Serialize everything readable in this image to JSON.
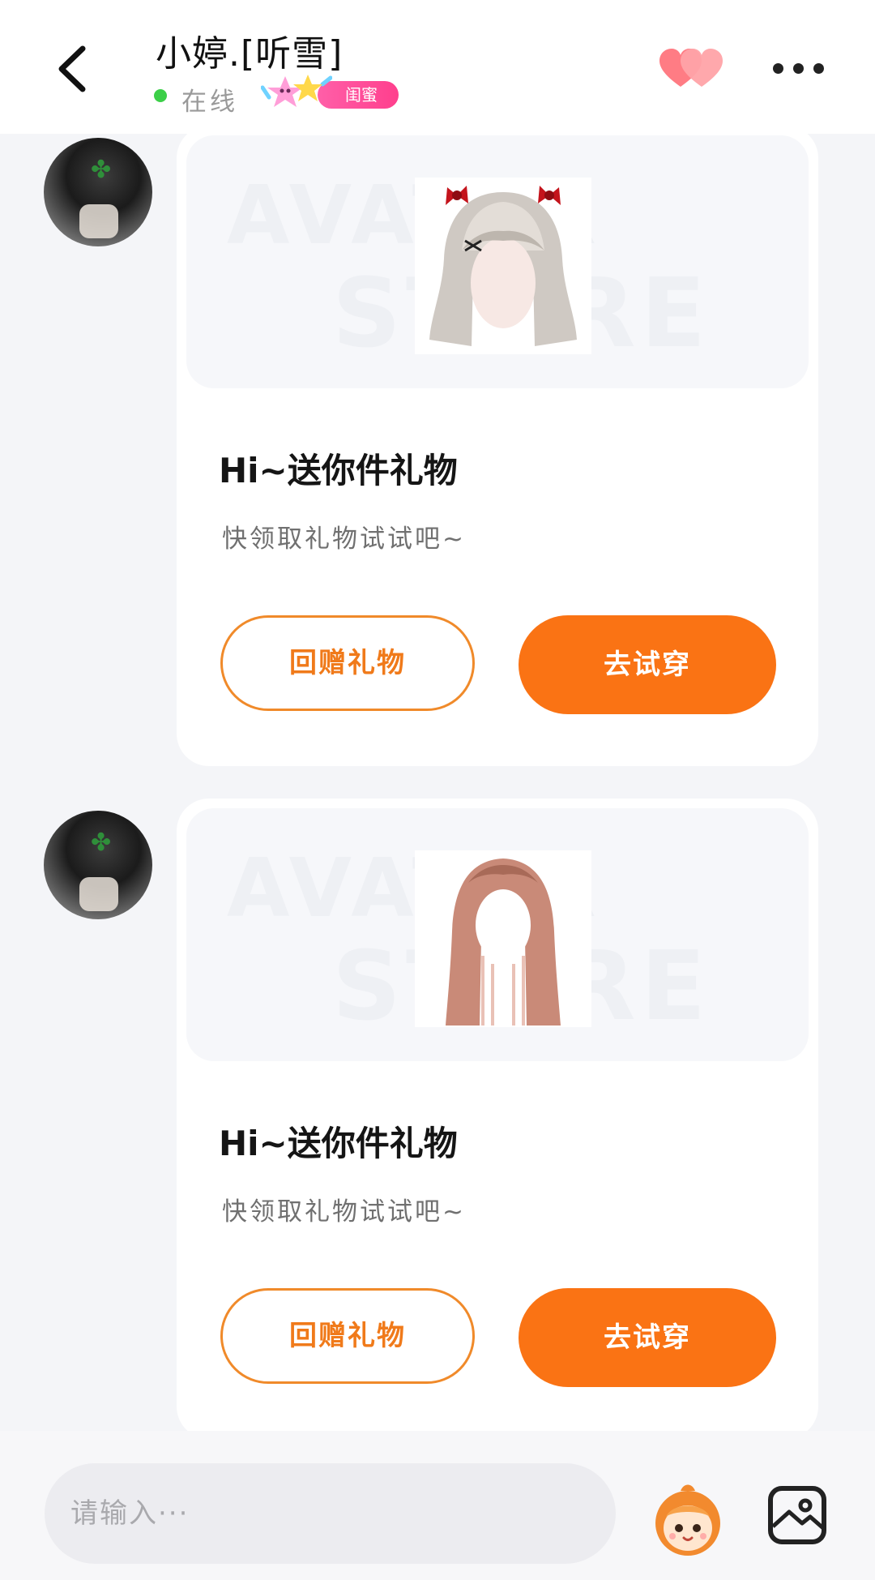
{
  "header": {
    "contact_name": "小婷.[听雪]",
    "status": "在线",
    "relation_badge": "闺蜜",
    "icons": {
      "back": "back-arrow-icon",
      "hearts": "double-heart-icon",
      "more": "more-dots-icon",
      "status_dot_color": "#3ccf48"
    }
  },
  "messages": [
    {
      "watermark_top": "AVATAR",
      "watermark_bottom": "STORE",
      "item": "hair-bangs-red-bows",
      "title": "Hi~送你件礼物",
      "subtitle": "快领取礼物试试吧~",
      "secondary_button": "回赠礼物",
      "primary_button": "去试穿"
    },
    {
      "watermark_top": "AVATAR",
      "watermark_bottom": "STORE",
      "item": "hair-long-pink-straight",
      "title": "Hi~送你件礼物",
      "subtitle": "快领取礼物试试吧~",
      "secondary_button": "回赠礼物",
      "primary_button": "去试穿"
    }
  ],
  "input": {
    "placeholder": "请输入···",
    "icons": {
      "mascot": "mascot-emoji-icon",
      "image": "image-icon"
    }
  },
  "colors": {
    "accent": "#fa7314",
    "badge_pink": "#ff3f8d",
    "background": "#f4f5f8"
  }
}
